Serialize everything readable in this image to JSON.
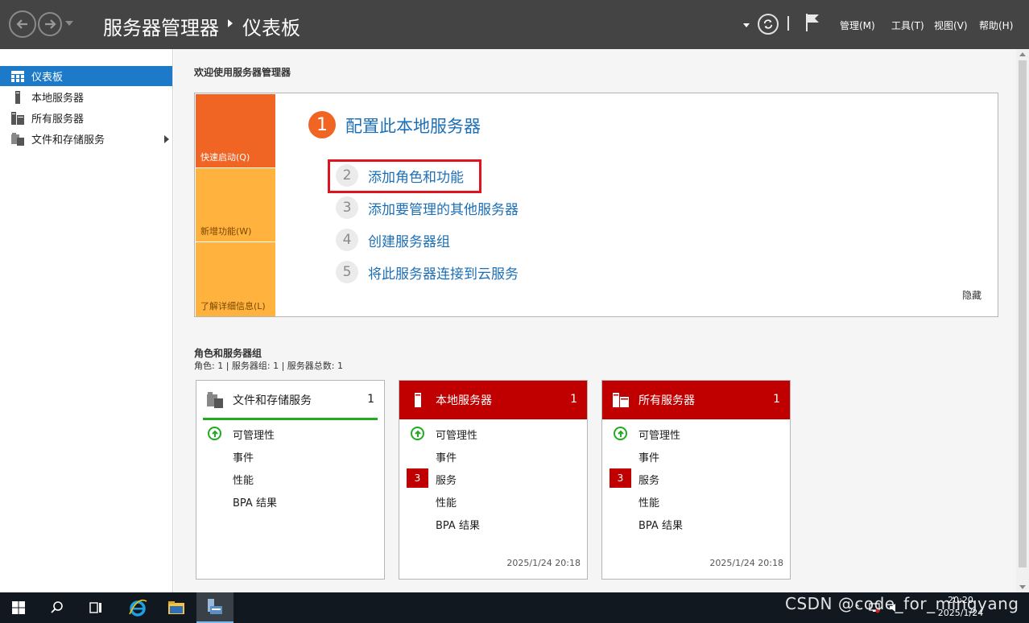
{
  "titlebar": {
    "breadcrumb_root": "服务器管理器",
    "breadcrumb_current": "仪表板",
    "menus": [
      "管理(M)",
      "工具(T)",
      "视图(V)",
      "帮助(H)"
    ]
  },
  "sidebar": {
    "items": [
      {
        "label": "仪表板",
        "icon": "dashboard-icon",
        "active": true
      },
      {
        "label": "本地服务器",
        "icon": "local-server-icon"
      },
      {
        "label": "所有服务器",
        "icon": "all-servers-icon"
      },
      {
        "label": "文件和存储服务",
        "icon": "file-storage-icon",
        "expandable": true
      }
    ]
  },
  "welcome": {
    "title": "欢迎使用服务器管理器",
    "tiles": [
      "快速启动(Q)",
      "新增功能(W)",
      "了解详细信息(L)"
    ],
    "step1": {
      "number": "1",
      "label": "配置此本地服务器"
    },
    "steps": [
      {
        "number": "2",
        "label": "添加角色和功能"
      },
      {
        "number": "3",
        "label": "添加要管理的其他服务器"
      },
      {
        "number": "4",
        "label": "创建服务器组"
      },
      {
        "number": "5",
        "label": "将此服务器连接到云服务"
      }
    ],
    "hide": "隐藏"
  },
  "roles": {
    "title": "角色和服务器组",
    "summary": "角色: 1 | 服务器组: 1 | 服务器总数: 1",
    "cards": [
      {
        "title": "文件和存储服务",
        "count": "1",
        "status": "ok",
        "rows": [
          "可管理性",
          "事件",
          "性能",
          "BPA 结果"
        ],
        "timestamp": ""
      },
      {
        "title": "本地服务器",
        "count": "1",
        "status": "error",
        "rows": [
          "可管理性",
          "事件",
          "服务",
          "性能",
          "BPA 结果"
        ],
        "service_alerts": "3",
        "timestamp": "2025/1/24 20:18"
      },
      {
        "title": "所有服务器",
        "count": "1",
        "status": "error",
        "rows": [
          "可管理性",
          "事件",
          "服务",
          "性能",
          "BPA 结果"
        ],
        "service_alerts": "3",
        "timestamp": "2025/1/24 20:18"
      }
    ]
  },
  "taskbar": {
    "clock_time": "20:20",
    "clock_date": "2025/1/24"
  },
  "watermark": "CSDN @code_for_mingyang",
  "colors": {
    "titlebar": "#444444",
    "accent": "#1d7ac9",
    "orange": "#f06424",
    "amber": "#ffb23e",
    "alert_red": "#c00000",
    "ok_green": "#22aa22",
    "highlight_box": "#e0141e"
  }
}
